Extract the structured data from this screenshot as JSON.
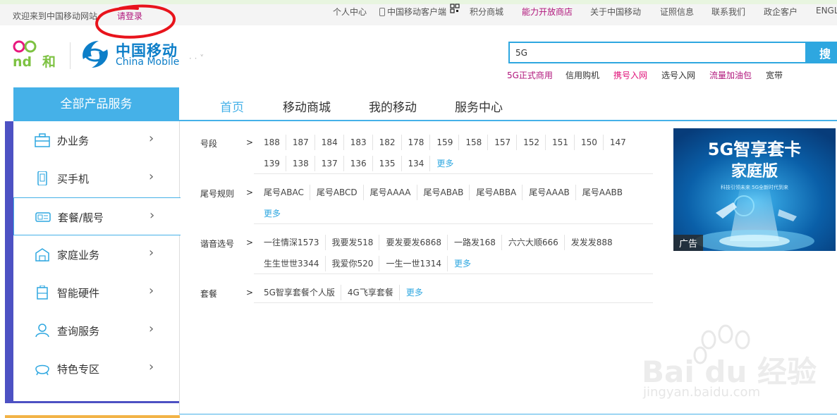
{
  "topbar": {
    "welcome": "欢迎来到中国移动网站",
    "login": "请登录",
    "links": [
      "个人中心",
      "中国移动客户端",
      "积分商城",
      "能力开放商店",
      "关于中国移动",
      "证照信息",
      "联系我们",
      "政企客户",
      "ENGL"
    ]
  },
  "header": {
    "logo_hey": "and和",
    "logo_cn": "中国移动",
    "logo_en": "China Mobile",
    "region": "·  ·  ˅"
  },
  "search": {
    "value": "5G",
    "button": "搜",
    "hotwords": [
      "5G正式商用",
      "信用购机",
      "携号入网",
      "选号入网",
      "流量加油包",
      "宽带"
    ]
  },
  "mainnav": {
    "all_products": "全部产品服务",
    "items": [
      "首页",
      "移动商城",
      "我的移动",
      "服务中心"
    ]
  },
  "sidebar": {
    "items": [
      {
        "label": "办业务",
        "icon": "briefcase-icon"
      },
      {
        "label": "买手机",
        "icon": "phone-icon"
      },
      {
        "label": "套餐/靓号",
        "icon": "sim-card-icon"
      },
      {
        "label": "家庭业务",
        "icon": "home-icon"
      },
      {
        "label": "智能硬件",
        "icon": "device-icon"
      },
      {
        "label": "查询服务",
        "icon": "user-icon"
      },
      {
        "label": "特色专区",
        "icon": "featured-icon"
      }
    ]
  },
  "panel": {
    "rows": [
      {
        "label": "号段",
        "lines": [
          [
            "188",
            "187",
            "184",
            "183",
            "182",
            "178",
            "159",
            "158",
            "157",
            "152",
            "151",
            "150",
            "147"
          ],
          [
            "139",
            "138",
            "137",
            "136",
            "135",
            "134"
          ]
        ],
        "more": "更多"
      },
      {
        "label": "尾号规则",
        "lines": [
          [
            "尾号ABAC",
            "尾号ABCD",
            "尾号AAAA",
            "尾号ABAB",
            "尾号ABBA",
            "尾号AAAB",
            "尾号AABB"
          ],
          []
        ],
        "more": "更多"
      },
      {
        "label": "谐音选号",
        "lines": [
          [
            "一往情深1573",
            "我要发518",
            "要发要发6868",
            "一路发168",
            "六六大顺666",
            "发发发888"
          ],
          [
            "生生世世3344",
            "我爱你520",
            "一生一世1314"
          ]
        ],
        "more": "更多"
      },
      {
        "label": "套餐",
        "lines": [
          [
            "5G智享套餐个人版",
            "4G飞享套餐"
          ]
        ],
        "more": "更多"
      }
    ],
    "gt": ">"
  },
  "ad": {
    "title": "5G智享套卡",
    "subtitle": "家庭版",
    "tagline": "科技引领未来 5G全新时代到来",
    "badge": "广告"
  },
  "watermark": {
    "text": "Bai du 经验",
    "sub": "jingyan.baidu.com"
  },
  "colors": {
    "accent_blue": "#45b1e8",
    "side_purple": "#4d51c3",
    "brand_pink": "#b0157b",
    "link_blue": "#2ea7e0"
  }
}
